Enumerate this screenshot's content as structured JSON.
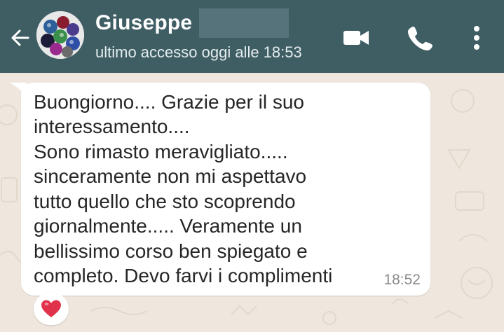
{
  "header": {
    "contact_name": "Giuseppe",
    "last_seen": "ultimo accesso oggi alle 18:53",
    "icons": [
      "back-arrow-icon",
      "video-call-icon",
      "phone-icon",
      "more-vertical-icon"
    ]
  },
  "message": {
    "lines": [
      "Buongiorno.... Grazie per il suo",
      "interessamento....",
      "Sono rimasto meravigliato.....",
      "sinceramente non mi aspettavo",
      "tutto quello che sto scoprendo",
      "giornalmente..... Veramente un",
      "bellissimo corso ben spiegato e",
      "completo. Devo farvi i complimenti"
    ],
    "time": "18:52",
    "reaction": "heart"
  },
  "colors": {
    "header_bg": "#3f5e64",
    "bubble_bg": "#ffffff",
    "wallpaper": "#efe7de",
    "reaction_heart": "#e0324a"
  }
}
